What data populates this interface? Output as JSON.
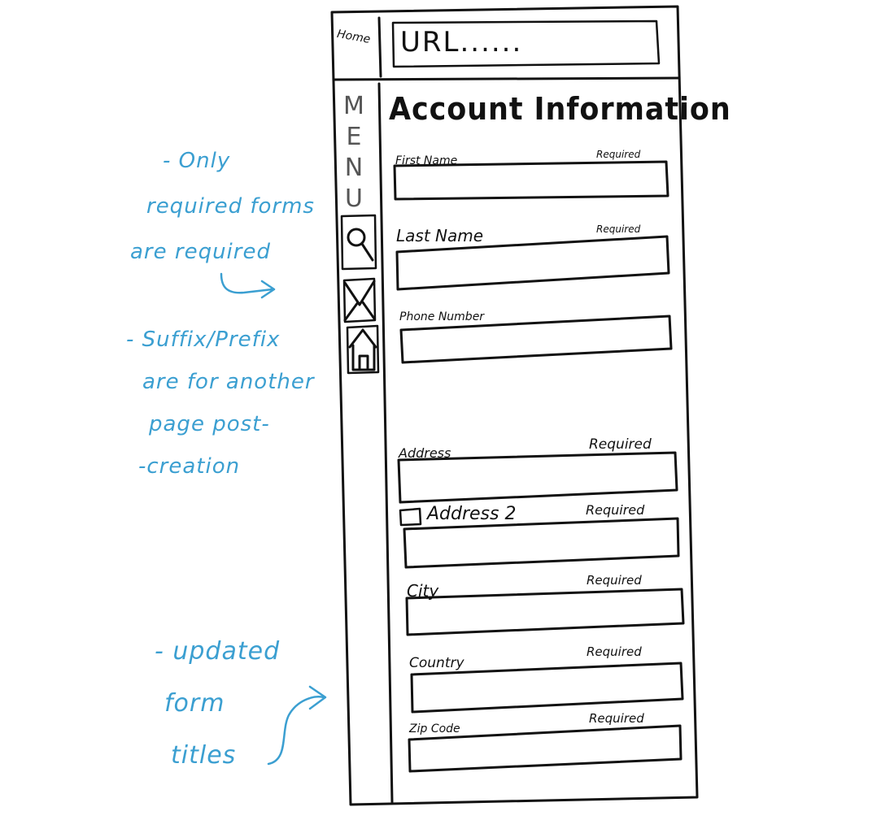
{
  "browser": {
    "home_label": "Home",
    "url_text": "URL......"
  },
  "sidebar": {
    "menu_letters": [
      "M",
      "E",
      "N",
      "U"
    ],
    "icons": [
      "search-icon",
      "mail-icon",
      "home-icon"
    ]
  },
  "form": {
    "title": "Account Information",
    "fields": [
      {
        "label": "First Name",
        "badge": "Required"
      },
      {
        "label": "Last Name",
        "badge": "Required"
      },
      {
        "label": "Phone Number",
        "badge": ""
      },
      {
        "label": "Address",
        "badge": "Required"
      },
      {
        "label": "Address 2",
        "badge": "Required"
      },
      {
        "label": "City",
        "badge": "Required"
      },
      {
        "label": "Country",
        "badge": "Required"
      },
      {
        "label": "Zip Code",
        "badge": "Required"
      }
    ]
  },
  "annotations": {
    "note1": [
      "- Only",
      "required forms",
      "are required"
    ],
    "note2": [
      "- Suffix/Prefix",
      "are for another",
      "page post-",
      "-creation"
    ],
    "note3": [
      "- updated",
      "form",
      "titles"
    ]
  },
  "colors": {
    "ink": "#111111",
    "annotation": "#3b9fd1"
  }
}
